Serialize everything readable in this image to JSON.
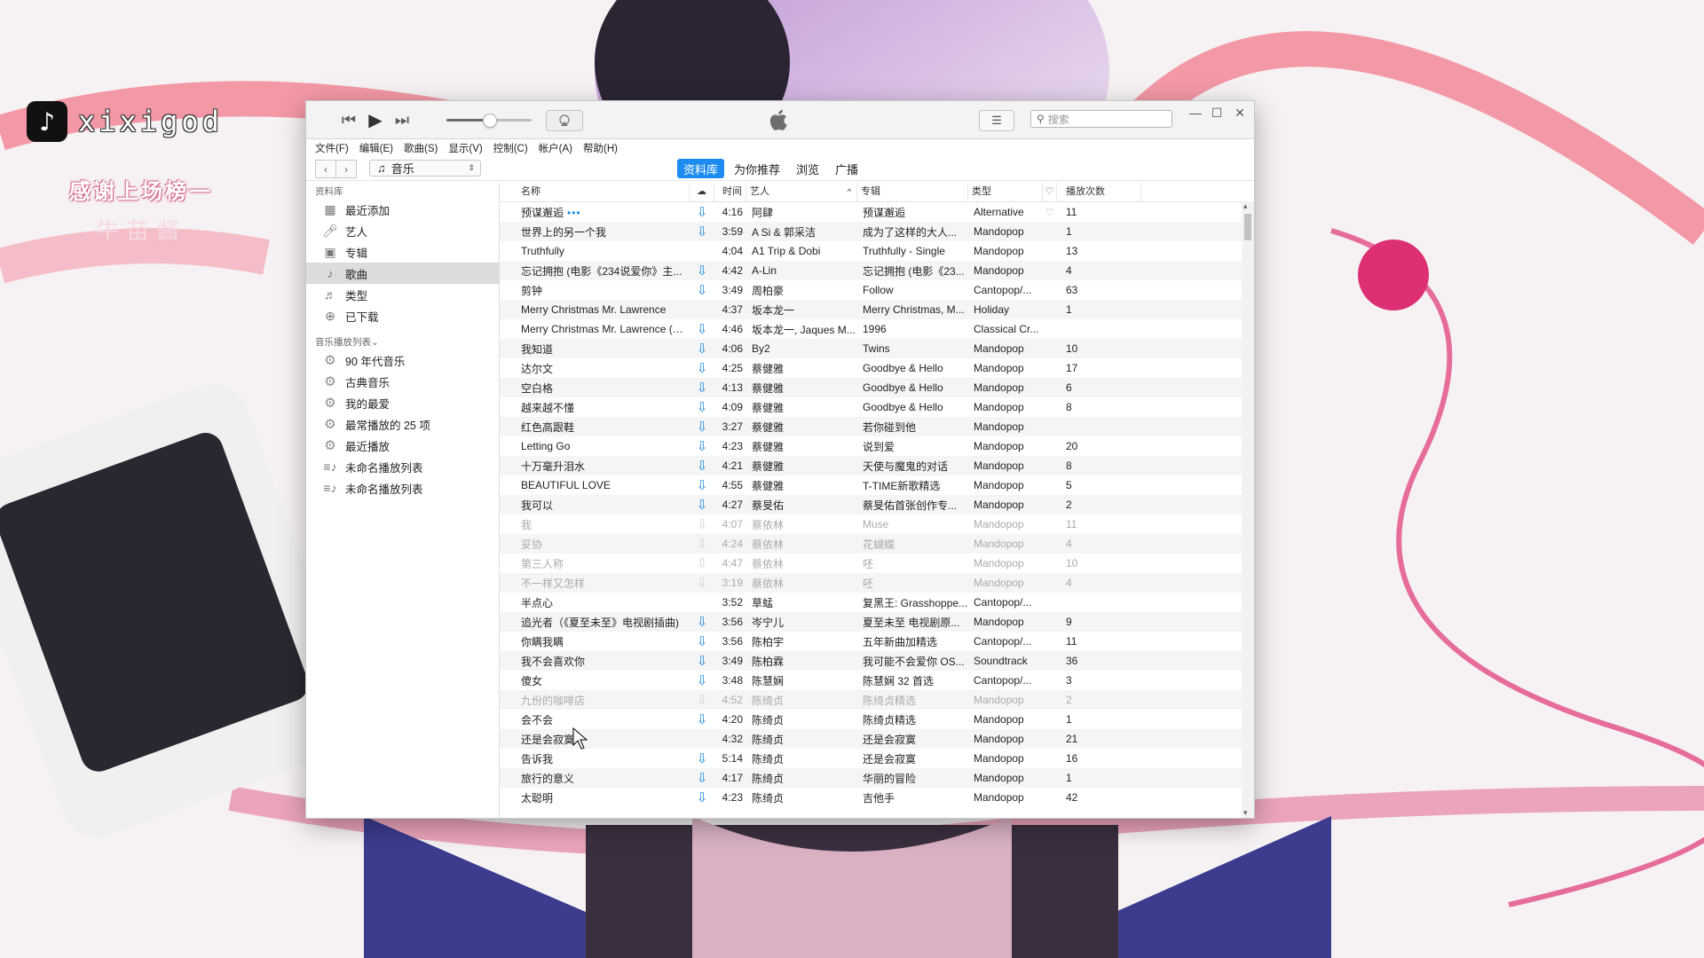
{
  "watermark": {
    "handle": "xixigod",
    "logo_glyph": "♪",
    "banner": "感谢上场榜一",
    "banner_name": "牛苗酱"
  },
  "player": {
    "prev_icon": "⏮",
    "play_icon": "▶",
    "next_icon": "⏭",
    "volume_level": 0.5
  },
  "search": {
    "placeholder": "搜索"
  },
  "menu": [
    "文件(F)",
    "编辑(E)",
    "歌曲(S)",
    "显示(V)",
    "控制(C)",
    "帐户(A)",
    "帮助(H)"
  ],
  "nav": {
    "media_select": "音乐"
  },
  "tabs": [
    {
      "label": "资料库",
      "active": true
    },
    {
      "label": "为你推荐",
      "active": false
    },
    {
      "label": "浏览",
      "active": false
    },
    {
      "label": "广播",
      "active": false
    }
  ],
  "sidebar": {
    "library_header": "资料库",
    "library": [
      {
        "label": "最近添加",
        "icon": "grid-icon"
      },
      {
        "label": "艺人",
        "icon": "microphone-icon"
      },
      {
        "label": "专辑",
        "icon": "album-icon"
      },
      {
        "label": "歌曲",
        "icon": "note-icon",
        "selected": true
      },
      {
        "label": "类型",
        "icon": "genre-icon"
      },
      {
        "label": "已下载",
        "icon": "download-icon"
      }
    ],
    "playlists_header": "音乐播放列表⌄",
    "playlists": [
      {
        "label": "90 年代音乐",
        "icon": "gear-icon"
      },
      {
        "label": "古典音乐",
        "icon": "gear-icon"
      },
      {
        "label": "我的最爱",
        "icon": "gear-icon"
      },
      {
        "label": "最常播放的 25 项",
        "icon": "gear-icon"
      },
      {
        "label": "最近播放",
        "icon": "gear-icon"
      },
      {
        "label": "未命名播放列表",
        "icon": "playlist-icon"
      },
      {
        "label": "未命名播放列表",
        "icon": "playlist-icon"
      }
    ]
  },
  "columns": {
    "name": "名称",
    "cloud": "☁",
    "time": "时间",
    "artist": "艺人",
    "sort": "^",
    "album": "专辑",
    "genre": "类型",
    "heart": "♡",
    "plays": "播放次数"
  },
  "songs": [
    {
      "name": "预谋邂逅",
      "dots": "•••",
      "cloud": true,
      "time": "4:16",
      "artist": "阿肆",
      "album": "预谋邂逅",
      "genre": "Alternative",
      "heart": "♡",
      "plays": "11"
    },
    {
      "name": "世界上的另一个我",
      "cloud": true,
      "time": "3:59",
      "artist": "A Si & 郭采洁",
      "album": "成为了这样的大人...",
      "genre": "Mandopop",
      "plays": "1"
    },
    {
      "name": "Truthfully",
      "cloud": false,
      "time": "4:04",
      "artist": "A1 Trip & Dobi",
      "album": "Truthfully - Single",
      "genre": "Mandopop",
      "plays": "13"
    },
    {
      "name": "忘记拥抱 (电影《234说爱你》主...",
      "cloud": true,
      "time": "4:42",
      "artist": "A-Lin",
      "album": "忘记拥抱 (电影《23...",
      "genre": "Mandopop",
      "plays": "4"
    },
    {
      "name": "剪钟",
      "cloud": true,
      "time": "3:49",
      "artist": "周柏豪",
      "album": "Follow",
      "genre": "Cantopop/...",
      "plays": "63"
    },
    {
      "name": "Merry Christmas Mr. Lawrence",
      "cloud": false,
      "time": "4:37",
      "artist": "坂本龙一",
      "album": "Merry Christmas, M...",
      "genre": "Holiday",
      "plays": "1"
    },
    {
      "name": "Merry Christmas Mr. Lawrence (Ve...",
      "cloud": true,
      "time": "4:46",
      "artist": "坂本龙一, Jaques M...",
      "album": "1996",
      "genre": "Classical Cr...",
      "plays": ""
    },
    {
      "name": "我知道",
      "cloud": true,
      "time": "4:06",
      "artist": "By2",
      "album": "Twins",
      "genre": "Mandopop",
      "plays": "10"
    },
    {
      "name": "达尔文",
      "cloud": true,
      "time": "4:25",
      "artist": "蔡健雅",
      "album": "Goodbye & Hello",
      "genre": "Mandopop",
      "plays": "17"
    },
    {
      "name": "空白格",
      "cloud": true,
      "time": "4:13",
      "artist": "蔡健雅",
      "album": "Goodbye & Hello",
      "genre": "Mandopop",
      "plays": "6"
    },
    {
      "name": "越来越不懂",
      "cloud": true,
      "time": "4:09",
      "artist": "蔡健雅",
      "album": "Goodbye & Hello",
      "genre": "Mandopop",
      "plays": "8"
    },
    {
      "name": "红色高跟鞋",
      "cloud": true,
      "time": "3:27",
      "artist": "蔡健雅",
      "album": "若你碰到他",
      "genre": "Mandopop",
      "plays": ""
    },
    {
      "name": "Letting Go",
      "cloud": true,
      "time": "4:23",
      "artist": "蔡健雅",
      "album": "说到爱",
      "genre": "Mandopop",
      "plays": "20"
    },
    {
      "name": "十万毫升泪水",
      "cloud": true,
      "time": "4:21",
      "artist": "蔡健雅",
      "album": "天使与魔鬼的对话",
      "genre": "Mandopop",
      "plays": "8"
    },
    {
      "name": "BEAUTIFUL LOVE",
      "cloud": true,
      "time": "4:55",
      "artist": "蔡健雅",
      "album": "T-TIME新歌精选",
      "genre": "Mandopop",
      "plays": "5"
    },
    {
      "name": "我可以",
      "cloud": true,
      "time": "4:27",
      "artist": "蔡旻佑",
      "album": "蔡旻佑首张创作专...",
      "genre": "Mandopop",
      "plays": "2"
    },
    {
      "name": "我",
      "cloud": true,
      "dim": true,
      "time": "4:07",
      "artist": "蔡依林",
      "album": "Muse",
      "genre": "Mandopop",
      "plays": "11"
    },
    {
      "name": "妥协",
      "cloud": true,
      "dim": true,
      "time": "4:24",
      "artist": "蔡依林",
      "album": "花蝴蝶",
      "genre": "Mandopop",
      "plays": "4"
    },
    {
      "name": "第三人称",
      "cloud": true,
      "dim": true,
      "time": "4:47",
      "artist": "蔡依林",
      "album": "呸",
      "genre": "Mandopop",
      "plays": "10"
    },
    {
      "name": "不一样又怎样",
      "cloud": true,
      "dim": true,
      "time": "3:19",
      "artist": "蔡依林",
      "album": "呸",
      "genre": "Mandopop",
      "plays": "4"
    },
    {
      "name": "半点心",
      "cloud": false,
      "time": "3:52",
      "artist": "草蜢",
      "album": "复黑王: Grasshoppe...",
      "genre": "Cantopop/...",
      "plays": ""
    },
    {
      "name": "追光者（《夏至未至》电视剧插曲)",
      "cloud": true,
      "time": "3:56",
      "artist": "岑宁儿",
      "album": "夏至未至 电视剧原...",
      "genre": "Mandopop",
      "plays": "9"
    },
    {
      "name": "你瞒我瞒",
      "cloud": true,
      "time": "3:56",
      "artist": "陈柏宇",
      "album": "五年新曲加精选",
      "genre": "Cantopop/...",
      "plays": "11"
    },
    {
      "name": "我不会喜欢你",
      "cloud": true,
      "time": "3:49",
      "artist": "陈柏霖",
      "album": "我可能不会爱你 OS...",
      "genre": "Soundtrack",
      "plays": "36"
    },
    {
      "name": "傻女",
      "cloud": true,
      "time": "3:48",
      "artist": "陈慧娴",
      "album": "陈慧娴 32 首选",
      "genre": "Cantopop/...",
      "plays": "3"
    },
    {
      "name": "九份的咖啡店",
      "cloud": true,
      "dim": true,
      "time": "4:52",
      "artist": "陈绮贞",
      "album": "陈绮贞精选",
      "genre": "Mandopop",
      "plays": "2"
    },
    {
      "name": "会不会",
      "cloud": true,
      "time": "4:20",
      "artist": "陈绮贞",
      "album": "陈绮贞精选",
      "genre": "Mandopop",
      "plays": "1"
    },
    {
      "name": "还是会寂寞",
      "cloud": false,
      "time": "4:32",
      "artist": "陈绮贞",
      "album": "还是会寂寞",
      "genre": "Mandopop",
      "plays": "21"
    },
    {
      "name": "告诉我",
      "cloud": true,
      "time": "5:14",
      "artist": "陈绮贞",
      "album": "还是会寂寞",
      "genre": "Mandopop",
      "plays": "16"
    },
    {
      "name": "旅行的意义",
      "cloud": true,
      "time": "4:17",
      "artist": "陈绮贞",
      "album": "华丽的冒险",
      "genre": "Mandopop",
      "plays": "1"
    },
    {
      "name": "太聪明",
      "cloud": true,
      "time": "4:23",
      "artist": "陈绮贞",
      "album": "吉他手",
      "genre": "Mandopop",
      "plays": "42"
    }
  ]
}
